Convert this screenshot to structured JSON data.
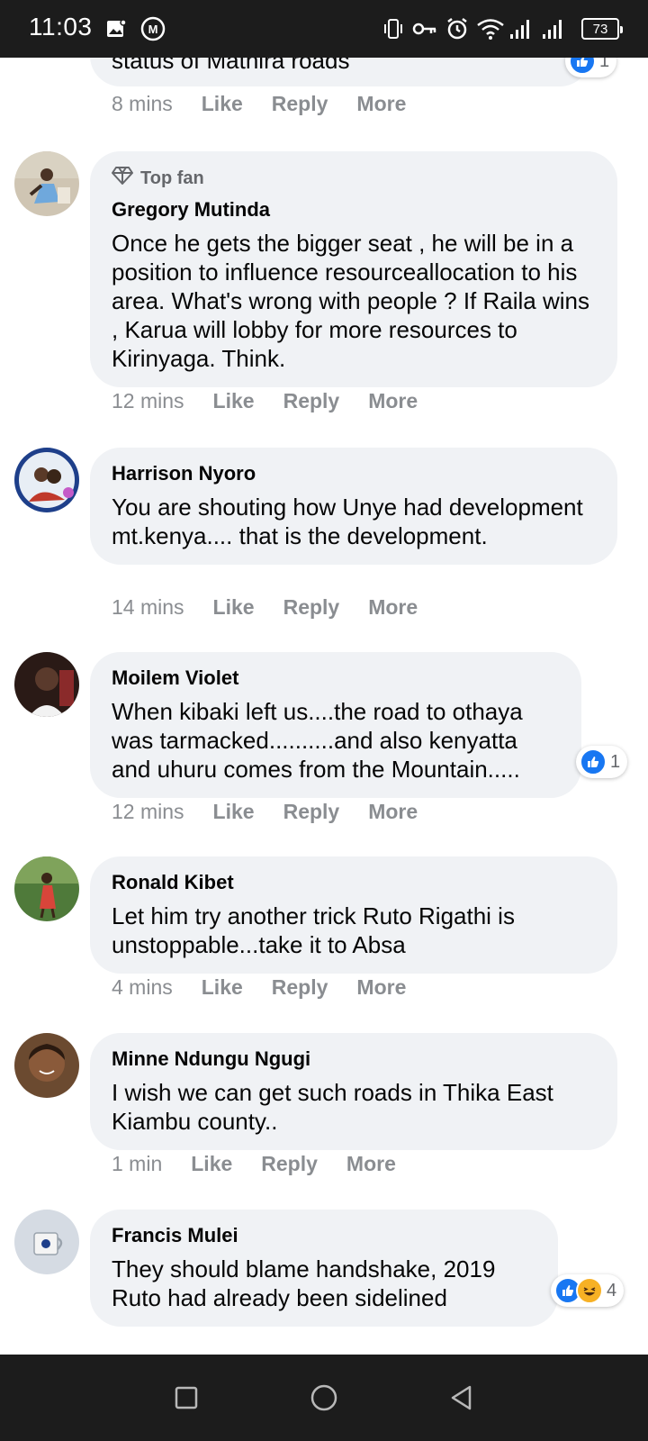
{
  "status_bar": {
    "time": "11:03",
    "battery": "73"
  },
  "partial_comment": {
    "text": "status of Mathira roads",
    "time": "8 mins",
    "like": "Like",
    "reply": "Reply",
    "more": "More",
    "reaction_count": "1"
  },
  "comments": [
    {
      "top_fan_label": "Top fan",
      "author": "Gregory Mutinda",
      "text": "Once he gets the bigger seat , he will be in a position to influence resourceallocation to his area. What's wrong with people ? If Raila wins , Karua will lobby for more resources to Kirinyaga. Think.",
      "time": "12 mins",
      "like": "Like",
      "reply": "Reply",
      "more": "More"
    },
    {
      "author": "Harrison Nyoro",
      "text": "You are shouting how Unye had development mt.kenya.... that is the development.",
      "time": "14 mins",
      "like": "Like",
      "reply": "Reply",
      "more": "More"
    },
    {
      "author": "Moilem Violet",
      "text": "When kibaki left us....the road to othaya was tarmacked..........and also kenyatta and uhuru comes from the Mountain.....",
      "time": "12 mins",
      "like": "Like",
      "reply": "Reply",
      "more": "More",
      "reaction_count": "1"
    },
    {
      "author": "Ronald Kibet",
      "text": "Let him try another trick Ruto Rigathi is unstoppable...take it to Absa",
      "time": "4 mins",
      "like": "Like",
      "reply": "Reply",
      "more": "More"
    },
    {
      "author": "Minne Ndungu Ngugi",
      "text": "I wish we can get such roads in Thika East Kiambu county..",
      "time": "1 min",
      "like": "Like",
      "reply": "Reply",
      "more": "More"
    },
    {
      "author": "Francis Mulei",
      "text": "They should blame handshake, 2019 Ruto had already been sidelined",
      "reaction_count": "4"
    }
  ],
  "icons": {
    "status": [
      "gallery-icon",
      "messenger-badge-icon",
      "vibrate-icon",
      "vpn-key-icon",
      "alarm-icon",
      "wifi-icon",
      "signal-icon"
    ],
    "nav": [
      "recents-square-icon",
      "home-circle-icon",
      "back-triangle-icon"
    ],
    "reactions": [
      "like-reaction-icon",
      "haha-reaction-icon"
    ],
    "badge": "diamond-icon"
  },
  "colors": {
    "bubble": "#f0f2f5",
    "meta_text": "#8a8d91",
    "like_blue": "#1877f2",
    "haha_yellow": "#f7b125",
    "system_bar": "#1c1c1c"
  }
}
